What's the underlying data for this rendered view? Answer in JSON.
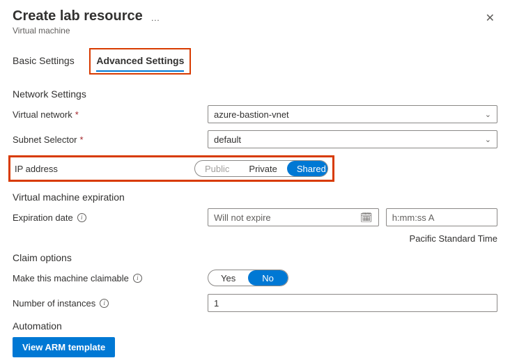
{
  "header": {
    "title": "Create lab resource",
    "subtitle": "Virtual machine",
    "ellipsis": "…"
  },
  "tabs": {
    "basic": "Basic Settings",
    "advanced": "Advanced Settings"
  },
  "network": {
    "heading": "Network Settings",
    "vnet_label": "Virtual network",
    "vnet_value": "azure-bastion-vnet",
    "subnet_label": "Subnet Selector",
    "subnet_value": "default",
    "ip_label": "IP address",
    "ip_options": {
      "public": "Public",
      "private": "Private",
      "shared": "Shared"
    }
  },
  "expiration": {
    "heading": "Virtual machine expiration",
    "date_label": "Expiration date",
    "date_placeholder": "Will not expire",
    "time_placeholder": "h:mm:ss A",
    "timezone": "Pacific Standard Time"
  },
  "claim": {
    "heading": "Claim options",
    "claimable_label": "Make this machine claimable",
    "yes": "Yes",
    "no": "No",
    "instances_label": "Number of instances",
    "instances_value": "1"
  },
  "automation": {
    "heading": "Automation",
    "view_arm": "View ARM template"
  }
}
